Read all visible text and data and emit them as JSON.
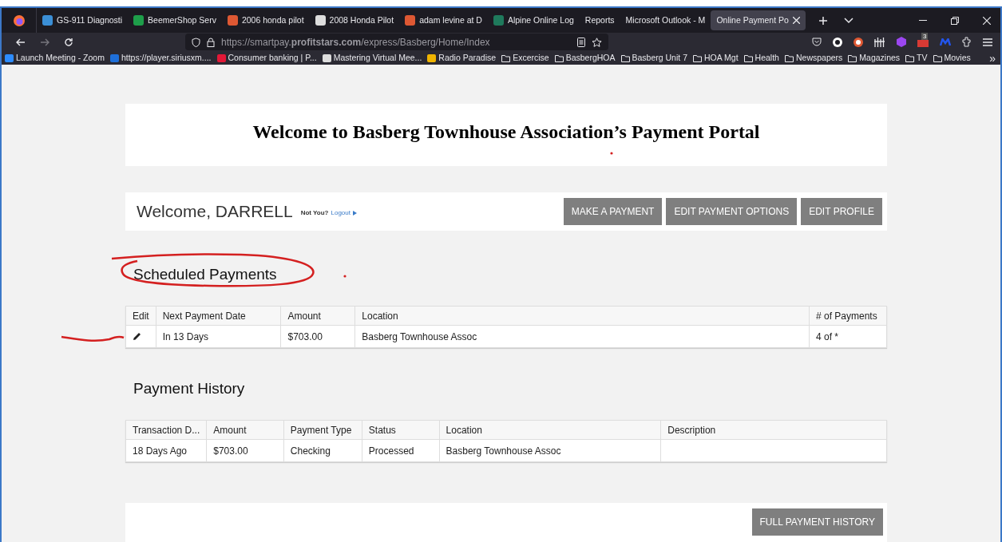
{
  "browser": {
    "tabs": [
      {
        "label": "GS-911 Diagnosti",
        "color": "#3b8fd6",
        "selected": false
      },
      {
        "label": "BeemerShop Serv",
        "color": "#1e9e4a",
        "selected": false
      },
      {
        "label": "2006 honda pilot",
        "color": "#de5833",
        "selected": false
      },
      {
        "label": "2008 Honda Pilot",
        "color": "#dddddd",
        "selected": false
      },
      {
        "label": "adam levine at D",
        "color": "#de5833",
        "selected": false
      },
      {
        "label": "Alpine Online Log",
        "color": "#1f7a5c",
        "selected": false
      },
      {
        "label": "Reports",
        "selected": false
      },
      {
        "label": "Microsoft Outlook - M",
        "selected": false
      },
      {
        "label": "Online Payment Po",
        "selected": true
      }
    ],
    "url": "https://smartpay.**profitstars.com**/express/Basberg/Home/Index",
    "extension_badge": "3",
    "bookmarks": [
      {
        "kind": "link",
        "label": "Launch Meeting - Zoom",
        "color": "#2d8cff"
      },
      {
        "kind": "link",
        "label": "https://player.siriusxm....",
        "color": "#1e6fd9"
      },
      {
        "kind": "link",
        "label": "Consumer banking | P...",
        "color": "#e31837"
      },
      {
        "kind": "link",
        "label": "Mastering Virtual Mee...",
        "color": "#dddddd"
      },
      {
        "kind": "link",
        "label": "Radio Paradise",
        "color": "#f0b400"
      },
      {
        "kind": "folder",
        "label": "Excercise"
      },
      {
        "kind": "folder",
        "label": "BasbergHOA"
      },
      {
        "kind": "folder",
        "label": "Basberg Unit 7"
      },
      {
        "kind": "folder",
        "label": "HOA Mgt"
      },
      {
        "kind": "folder",
        "label": "Health"
      },
      {
        "kind": "folder",
        "label": "Newspapers"
      },
      {
        "kind": "folder",
        "label": "Magazines"
      },
      {
        "kind": "folder",
        "label": "TV"
      },
      {
        "kind": "folder",
        "label": "Movies"
      }
    ],
    "bookmarks_overflow": "»"
  },
  "page": {
    "title": "Welcome to Basberg Townhouse Association’s Payment Portal",
    "welcome": "Welcome, DARRELL",
    "not_you": "Not You?",
    "logout": "Logout",
    "buttons": [
      "MAKE A PAYMENT",
      "EDIT PAYMENT OPTIONS",
      "EDIT PROFILE"
    ],
    "scheduled": {
      "heading": "Scheduled Payments",
      "columns": [
        "Edit",
        "Next Payment Date",
        "Amount",
        "Location",
        "# of Payments"
      ],
      "rows": [
        [
          "",
          "In 13 Days",
          "$703.00",
          "Basberg Townhouse Assoc",
          "4 of *"
        ]
      ]
    },
    "history": {
      "heading": "Payment History",
      "columns": [
        "Transaction D...",
        "Amount",
        "Payment Type",
        "Status",
        "Location",
        "Description"
      ],
      "rows": [
        [
          "18 Days Ago",
          "$703.00",
          "Checking",
          "Processed",
          "Basberg Townhouse Assoc",
          ""
        ]
      ]
    },
    "full_history_button": "FULL PAYMENT HISTORY"
  }
}
